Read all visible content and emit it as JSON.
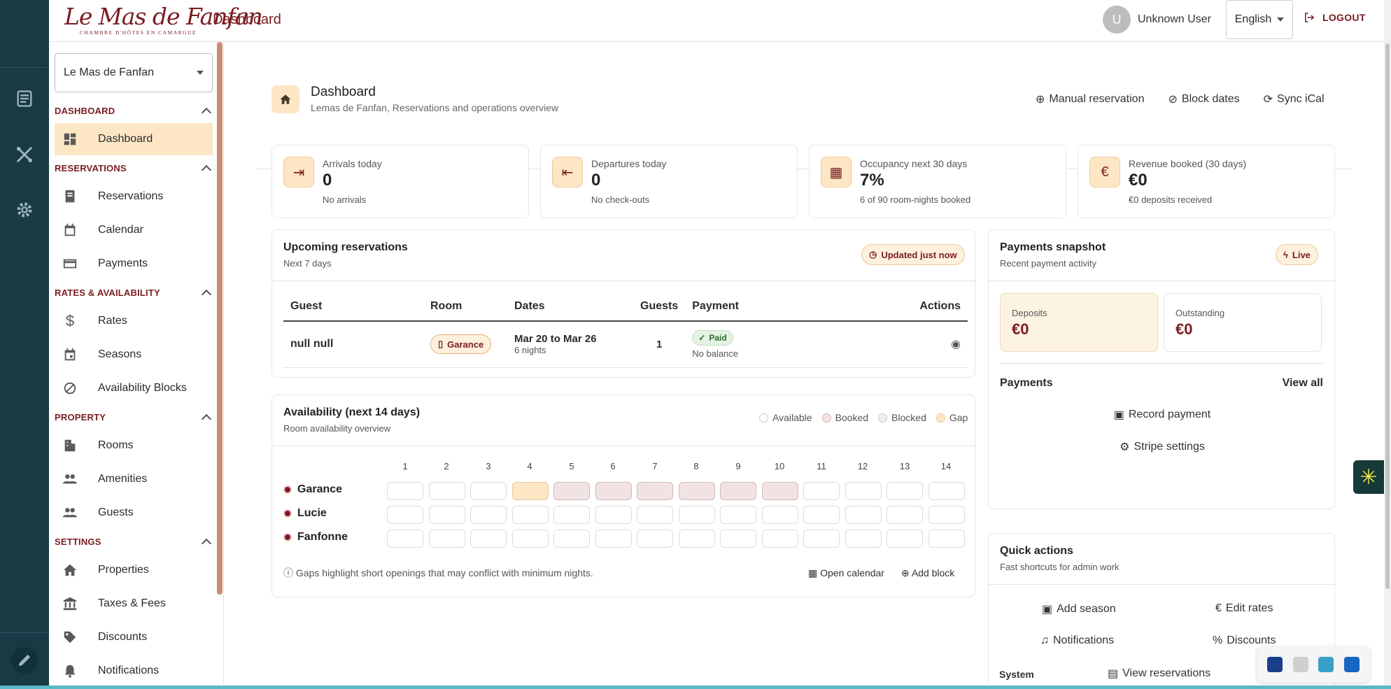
{
  "brand": {
    "logo_text": "Le Mas de Fanfan",
    "logo_tagline": "CHAMBRE D'HÔTES EN CAMARGUE",
    "page_title": "Dashboard"
  },
  "header": {
    "avatar_initial": "U",
    "user_name": "Unknown User",
    "language": "English",
    "logout": "LOGOUT"
  },
  "sidebar": {
    "property_select": "Le Mas de Fanfan",
    "sections": [
      {
        "title": "DASHBOARD",
        "items": [
          {
            "label": "Dashboard",
            "icon": "dashboard-icon",
            "active": true
          }
        ]
      },
      {
        "title": "RESERVATIONS",
        "items": [
          {
            "label": "Reservations",
            "icon": "receipt-icon"
          },
          {
            "label": "Calendar",
            "icon": "calendar-icon"
          },
          {
            "label": "Payments",
            "icon": "credit-card-icon"
          }
        ]
      },
      {
        "title": "RATES & AVAILABILITY",
        "items": [
          {
            "label": "Rates",
            "icon": "dollar-icon"
          },
          {
            "label": "Seasons",
            "icon": "calendar-event-icon"
          },
          {
            "label": "Availability Blocks",
            "icon": "block-icon"
          }
        ]
      },
      {
        "title": "PROPERTY",
        "items": [
          {
            "label": "Rooms",
            "icon": "building-icon"
          },
          {
            "label": "Amenities",
            "icon": "people-icon"
          },
          {
            "label": "Guests",
            "icon": "people-icon"
          }
        ]
      },
      {
        "title": "SETTINGS",
        "items": [
          {
            "label": "Properties",
            "icon": "home-icon"
          },
          {
            "label": "Taxes & Fees",
            "icon": "bank-icon"
          },
          {
            "label": "Discounts",
            "icon": "tag-icon"
          },
          {
            "label": "Notifications",
            "icon": "bell-icon"
          }
        ]
      }
    ]
  },
  "page_header": {
    "title": "Dashboard",
    "subtitle": "Lemas de Fanfan, Reservations and operations overview",
    "actions": [
      {
        "label": "Manual reservation",
        "icon": "plus-circle-icon"
      },
      {
        "label": "Block dates",
        "icon": "block-icon"
      },
      {
        "label": "Sync iCal",
        "icon": "sync-icon"
      }
    ]
  },
  "stats": [
    {
      "label": "Arrivals today",
      "value": "0",
      "sub": "No arrivals",
      "icon": "login-icon"
    },
    {
      "label": "Departures today",
      "value": "0",
      "sub": "No check-outs",
      "icon": "logout-icon"
    },
    {
      "label": "Occupancy next 30 days",
      "value": "7%",
      "sub": "6 of 90 room-nights booked",
      "icon": "calendar-chart-icon"
    },
    {
      "label": "Revenue booked (30 days)",
      "value": "€0",
      "sub": "€0 deposits received",
      "icon": "euro-icon"
    }
  ],
  "upcoming": {
    "title": "Upcoming reservations",
    "subtitle": "Next 7 days",
    "badge": "Updated just now",
    "columns": [
      "Guest",
      "Room",
      "Dates",
      "Guests",
      "Payment",
      "Actions"
    ],
    "rows": [
      {
        "guest": "null null",
        "room": "Garance",
        "dates": "Mar 20 to Mar 26",
        "nights": "6 nights",
        "guests": "1",
        "payment_status": "Paid",
        "payment_note": "No balance"
      }
    ]
  },
  "availability": {
    "title": "Availability (next 14 days)",
    "subtitle": "Room availability overview",
    "legend": [
      "Available",
      "Booked",
      "Blocked",
      "Gap"
    ],
    "days": [
      "1",
      "2",
      "3",
      "4",
      "5",
      "6",
      "7",
      "8",
      "9",
      "10",
      "11",
      "12",
      "13",
      "14"
    ],
    "rooms": [
      {
        "name": "Garance",
        "cells": [
          "available",
          "available",
          "available",
          "gap",
          "booked",
          "booked",
          "booked",
          "booked",
          "booked",
          "booked",
          "available",
          "available",
          "available",
          "available"
        ]
      },
      {
        "name": "Lucie",
        "cells": [
          "available",
          "available",
          "available",
          "available",
          "available",
          "available",
          "available",
          "available",
          "available",
          "available",
          "available",
          "available",
          "available",
          "available"
        ]
      },
      {
        "name": "Fanfonne",
        "cells": [
          "available",
          "available",
          "available",
          "available",
          "available",
          "available",
          "available",
          "available",
          "available",
          "available",
          "available",
          "available",
          "available",
          "available"
        ]
      }
    ],
    "note": "Gaps highlight short openings that may conflict with minimum nights.",
    "open_calendar": "Open calendar",
    "add_block": "Add block"
  },
  "payments": {
    "title": "Payments snapshot",
    "subtitle": "Recent payment activity",
    "badge": "Live",
    "deposits_label": "Deposits",
    "deposits_value": "€0",
    "outstanding_label": "Outstanding",
    "outstanding_value": "€0",
    "section_title": "Payments",
    "view_all": "View all",
    "record_payment": "Record payment",
    "stripe_settings": "Stripe settings"
  },
  "quick_actions": {
    "title": "Quick actions",
    "subtitle": "Fast shortcuts for admin work",
    "add_season": "Add season",
    "edit_rates": "Edit rates",
    "notifications": "Notifications",
    "discounts": "Discounts",
    "view_reservations": "View reservations",
    "system": "System"
  },
  "colors": {
    "brand": "#7a1d22",
    "accent_bg": "#fde6c4",
    "rail": "#173a45"
  }
}
